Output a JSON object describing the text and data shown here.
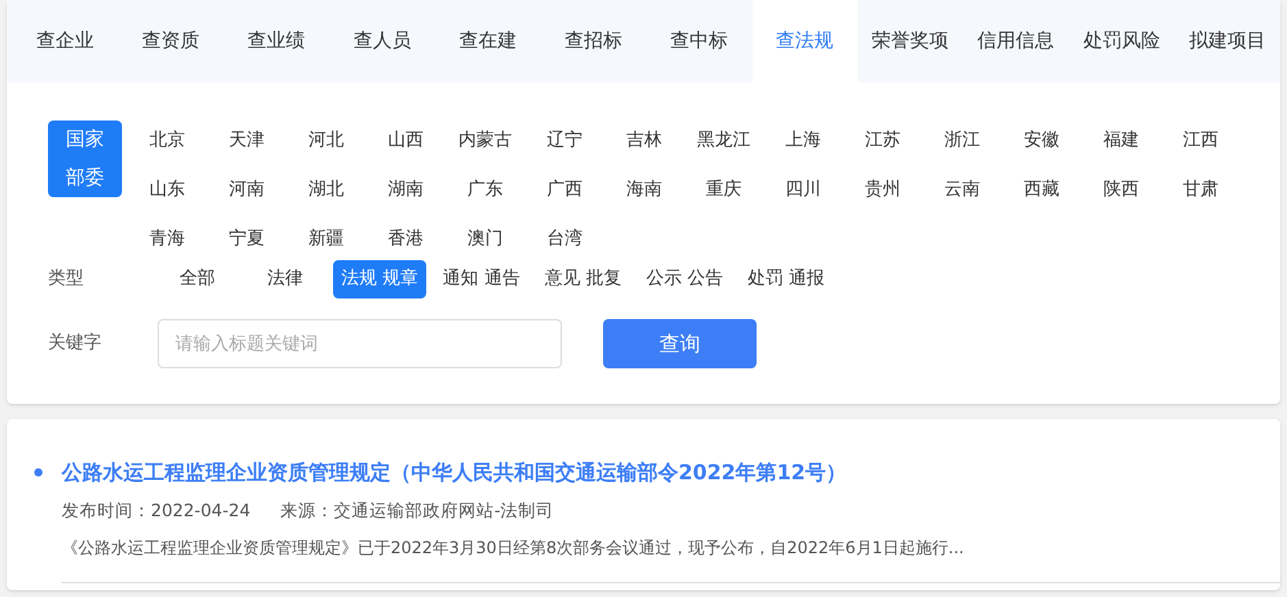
{
  "tabs": [
    {
      "label": "查企业",
      "selected": false
    },
    {
      "label": "查资质",
      "selected": false
    },
    {
      "label": "查业绩",
      "selected": false
    },
    {
      "label": "查人员",
      "selected": false
    },
    {
      "label": "查在建",
      "selected": false
    },
    {
      "label": "查招标",
      "selected": false
    },
    {
      "label": "查中标",
      "selected": false
    },
    {
      "label": "查法规",
      "selected": true
    },
    {
      "label": "荣誉奖项",
      "selected": false
    },
    {
      "label": "信用信息",
      "selected": false
    },
    {
      "label": "处罚风险",
      "selected": false
    },
    {
      "label": "拟建项目",
      "selected": false
    }
  ],
  "national": {
    "label": "国家部委",
    "selected": true
  },
  "regions": [
    {
      "label": "北京",
      "selected": false
    },
    {
      "label": "天津",
      "selected": false
    },
    {
      "label": "河北",
      "selected": false
    },
    {
      "label": "山西",
      "selected": false
    },
    {
      "label": "内蒙古",
      "selected": false
    },
    {
      "label": "辽宁",
      "selected": false
    },
    {
      "label": "吉林",
      "selected": false
    },
    {
      "label": "黑龙江",
      "selected": false
    },
    {
      "label": "上海",
      "selected": false
    },
    {
      "label": "江苏",
      "selected": false
    },
    {
      "label": "浙江",
      "selected": false
    },
    {
      "label": "安徽",
      "selected": false
    },
    {
      "label": "福建",
      "selected": false
    },
    {
      "label": "江西",
      "selected": false
    },
    {
      "label": "山东",
      "selected": false
    },
    {
      "label": "河南",
      "selected": false
    },
    {
      "label": "湖北",
      "selected": false
    },
    {
      "label": "湖南",
      "selected": false
    },
    {
      "label": "广东",
      "selected": false
    },
    {
      "label": "广西",
      "selected": false
    },
    {
      "label": "海南",
      "selected": false
    },
    {
      "label": "重庆",
      "selected": false
    },
    {
      "label": "四川",
      "selected": false
    },
    {
      "label": "贵州",
      "selected": false
    },
    {
      "label": "云南",
      "selected": false
    },
    {
      "label": "西藏",
      "selected": false
    },
    {
      "label": "陕西",
      "selected": false
    },
    {
      "label": "甘肃",
      "selected": false
    },
    {
      "label": "青海",
      "selected": false
    },
    {
      "label": "宁夏",
      "selected": false
    },
    {
      "label": "新疆",
      "selected": false
    },
    {
      "label": "香港",
      "selected": false
    },
    {
      "label": "澳门",
      "selected": false
    },
    {
      "label": "台湾",
      "selected": false
    }
  ],
  "type_filter": {
    "label": "类型",
    "options": [
      {
        "label": "全部",
        "selected": false
      },
      {
        "label": "法律",
        "selected": false
      },
      {
        "label": "法规 规章",
        "selected": true
      },
      {
        "label": "通知 通告",
        "selected": false
      },
      {
        "label": "意见 批复",
        "selected": false
      },
      {
        "label": "公示 公告",
        "selected": false
      },
      {
        "label": "处罚 通报",
        "selected": false
      }
    ]
  },
  "keyword": {
    "label": "关键字",
    "placeholder": "请输入标题关键词",
    "button": "查询"
  },
  "results": [
    {
      "title": "公路水运工程监理企业资质管理规定（中华人民共和国交通运输部令2022年第12号）",
      "date": "发布时间：2022-04-24",
      "source": "来源：交通运输部政府网站-法制司",
      "summary": "《公路水运工程监理企业资质管理规定》已于2022年3月30日经第8次部务会议通过，现予公布，自2022年6月1日起施行..."
    }
  ]
}
